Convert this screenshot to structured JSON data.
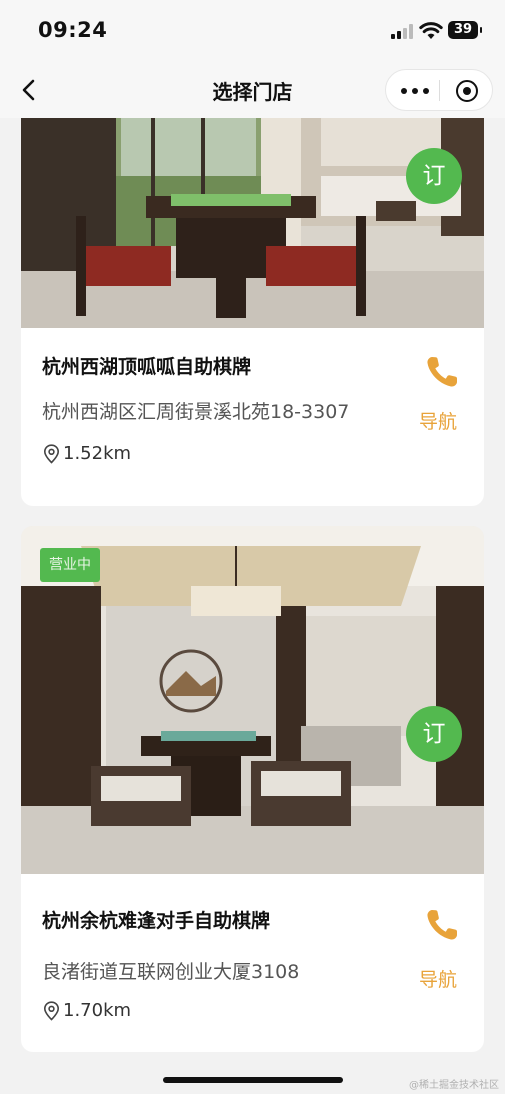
{
  "status_bar": {
    "time": "09:24",
    "battery": "39"
  },
  "nav_bar": {
    "title": "选择门店"
  },
  "stores": [
    {
      "name": "杭州西湖顶呱呱自助棋牌",
      "address": "杭州西湖区汇周街景溪北苑18-3307",
      "distance": "1.52km",
      "book_label": "订",
      "nav_label": "导航"
    },
    {
      "name": "杭州余杭难逢对手自助棋牌",
      "address": "良渚街道互联网创业大厦3108",
      "distance": "1.70km",
      "book_label": "订",
      "nav_label": "导航",
      "status_badge": "营业中"
    }
  ],
  "watermark": "@稀土掘金技术社区",
  "colors": {
    "accent_green": "#53b94f",
    "accent_orange": "#e8a33a"
  },
  "icons": [
    "signal-icon",
    "wifi-icon",
    "battery-icon",
    "back-icon",
    "more-icon",
    "close-miniprogram-icon",
    "phone-icon",
    "location-pin-icon"
  ]
}
